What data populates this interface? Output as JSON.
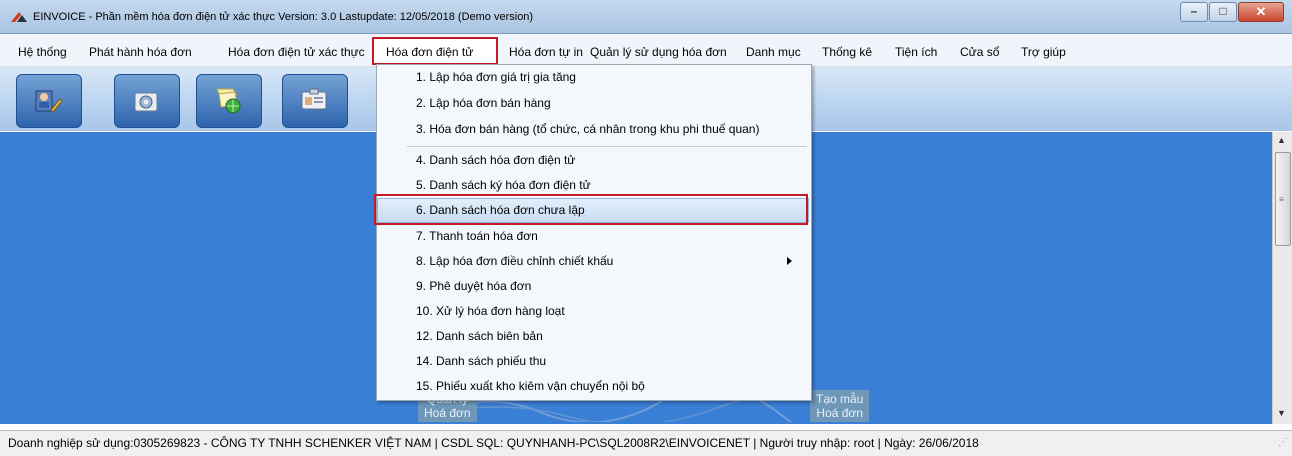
{
  "window": {
    "title_main": "EINVOICE - Phần mềm hóa đơn điện tử xác thực Version: 3.0 Lastupdate: 12/05/2018 (Demo version)",
    "min_glyph": "–",
    "max_glyph": "□",
    "close_glyph": "✕"
  },
  "menu": [
    "Hệ thống",
    "Phát hành hóa đơn",
    "Hóa đơn điện tử xác thực",
    "Hóa đơn điện tử",
    "Hóa đơn tự in",
    "Quản lý sử dụng hóa đơn",
    "Danh mục",
    "Thống kê",
    "Tiện ích",
    "Cửa sổ",
    "Trợ giúp"
  ],
  "active_menu_index": 3,
  "toolbar_icons": [
    "user-edit-icon",
    "settings-icon",
    "publish-document-icon",
    "id-card-icon"
  ],
  "dropdown": {
    "items": [
      "1. Lập hóa đơn giá trị gia tăng",
      "2. Lập hóa đơn bán hàng",
      "3. Hóa đơn bán hàng (tổ chức, cá nhân trong khu phi thuế quan)",
      "4. Danh sách hóa đơn điện tử",
      "5. Danh sách ký hóa đơn điện tử",
      "6. Danh sách hóa đơn chưa lập",
      "7. Thanh toán hóa đơn",
      "8. Lập hóa đơn điều chỉnh chiết khấu",
      "9. Phê duyệt hóa đơn",
      "10. Xử lý hóa đơn hàng loạt",
      "12. Danh sách biên bản",
      "14. Danh sách phiếu thu",
      "15. Phiếu xuất kho kiêm vận chuyển nội bộ"
    ],
    "highlighted_index": 5,
    "submenu_index": 7
  },
  "background_tiles": {
    "left": "Quản lý\nHoá đơn",
    "right": "Tạo mẫu\nHoá đơn"
  },
  "status": {
    "text": "Doanh nghiệp sử dụng:0305269823  - CÔNG TY TNHH SCHENKER VIỆT NAM  |  CSDL SQL: QUYNHANH-PC\\SQL2008R2\\EINVOICENET  |  Người truy nhập: root  |  Ngày: 26/06/2018"
  }
}
